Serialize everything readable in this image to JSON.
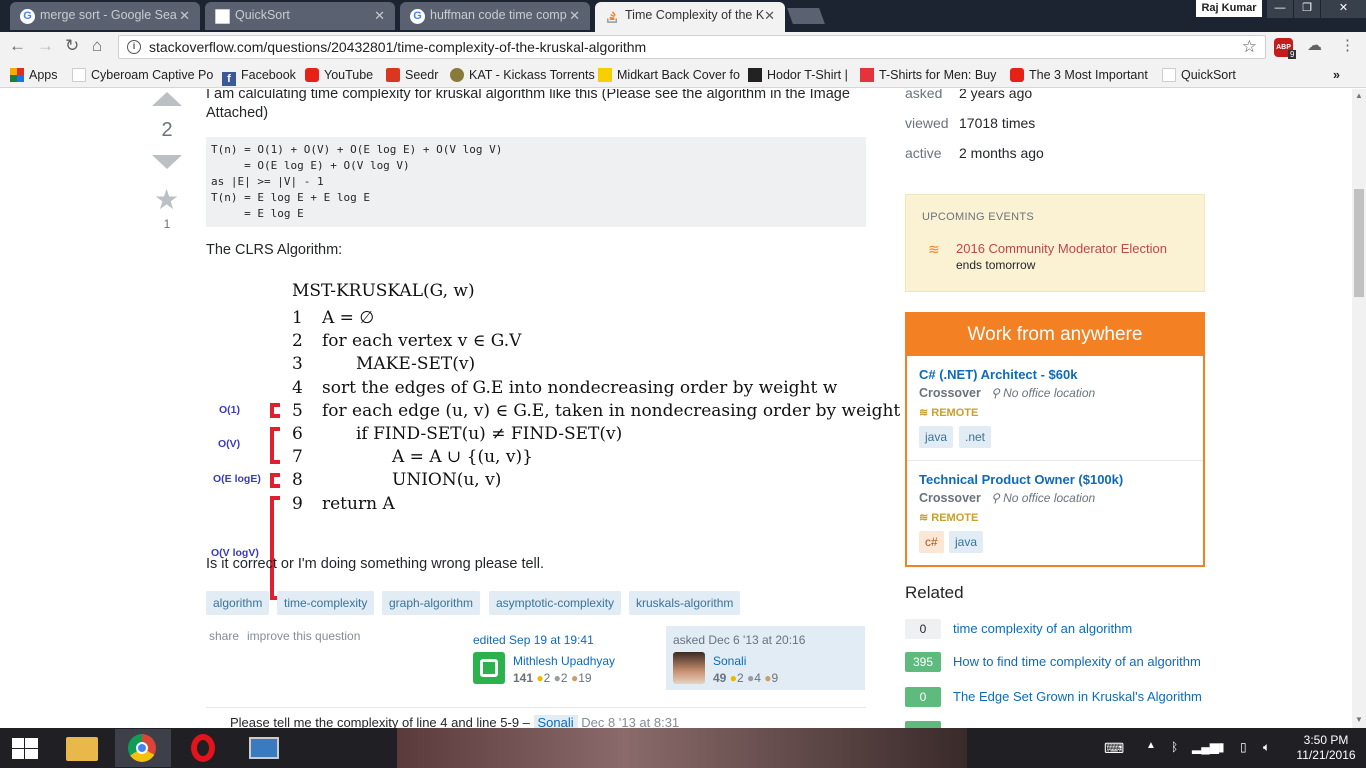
{
  "browser": {
    "tabs": [
      {
        "label": "merge sort - Google Sea",
        "icon": "google-icon"
      },
      {
        "label": "QuickSort",
        "icon": "document-icon"
      },
      {
        "label": "huffman code time comp",
        "icon": "google-icon"
      },
      {
        "label": "Time Complexity of the K",
        "icon": "stackoverflow-icon"
      }
    ],
    "user_name": "Raj Kumar",
    "url": "stackoverflow.com/questions/20432801/time-complexity-of-the-kruskal-algorithm",
    "abp_count": "9",
    "bookmarks": [
      "Apps",
      "Cyberoam Captive Po",
      "Facebook",
      "YouTube",
      "Seedr",
      "KAT - Kickass Torrents",
      "Midkart Back Cover fo",
      "Hodor T-Shirt |",
      "T-Shirts for Men: Buy",
      "The 3 Most Important",
      "QuickSort"
    ],
    "more": "»"
  },
  "question": {
    "votes": "2",
    "favorites": "1",
    "intro": "I am calculating time complexity for kruskal algorithm like this (Please see the algorithm in the Image Attached)",
    "code_lines": [
      "T(n) = O(1) + O(V) + O(E log E) + O(V log V)",
      "     = O(E log E) + O(V log V)",
      "as |E| >= |V| - 1",
      "T(n) = E log E + E log E",
      "     = E log E"
    ],
    "clrs_label": "The CLRS Algorithm:",
    "outro": "Is it correct or I'm doing something wrong please tell.",
    "tags": [
      "algorithm",
      "time-complexity",
      "graph-algorithm",
      "asymptotic-complexity",
      "kruskals-algorithm"
    ],
    "share": "share",
    "improve": "improve this question",
    "edited": {
      "when": "edited Sep 19 at 19:41",
      "name": "Mithlesh Upadhyay",
      "rep": "141",
      "gold": "2",
      "silver": "2",
      "bronze": "19"
    },
    "asked": {
      "when": "asked Dec 6 '13 at 20:16",
      "name": "Sonali",
      "rep": "49",
      "gold": "2",
      "silver": "4",
      "bronze": "9"
    },
    "comment": {
      "text": "Please tell me the complexity of line 4 and line 5-9 –",
      "user": "Sonali",
      "date": "Dec 8 '13 at 8:31"
    }
  },
  "algorithm": {
    "title": "MST-KRUSKAL(G, w)",
    "lines": [
      {
        "num": "1",
        "text": "A = ∅"
      },
      {
        "num": "2",
        "text": "for each vertex v ∈ G.V"
      },
      {
        "num": "3",
        "text": "MAKE-SET(v)"
      },
      {
        "num": "4",
        "text": "sort the edges of G.E into nondecreasing order by weight w"
      },
      {
        "num": "5",
        "text": "for each edge (u, v) ∈ G.E, taken in nondecreasing order by weight"
      },
      {
        "num": "6",
        "text": "if FIND-SET(u) ≠ FIND-SET(v)"
      },
      {
        "num": "7",
        "text": "A = A ∪ {(u, v)}"
      },
      {
        "num": "8",
        "text": "UNION(u, v)"
      },
      {
        "num": "9",
        "text": "return A"
      }
    ],
    "complexities": [
      "O(1)",
      "O(V)",
      "O(E logE)",
      "O(V logV)"
    ],
    "bracket_color": "#e0202e",
    "label_color": "#3a3ac0"
  },
  "sidebar": {
    "asked_label": "asked",
    "asked_value": "2 years ago",
    "viewed_label": "viewed",
    "viewed_value": "17018 times",
    "active_label": "active",
    "active_value": "2 months ago",
    "events_header": "UPCOMING EVENTS",
    "event_title": "2016 Community Moderator Election",
    "event_sub": "ends tomorrow",
    "jobs_header": "Work from anywhere",
    "jobs": [
      {
        "title": "C# (.NET) Architect - $60k",
        "company": "Crossover",
        "location": "No office location",
        "remote": "REMOTE",
        "tags": [
          "java",
          ".net"
        ]
      },
      {
        "title": "Technical Product Owner ($100k)",
        "company": "Crossover",
        "location": "No office location",
        "remote": "REMOTE",
        "tags": [
          "c#",
          "java"
        ]
      }
    ],
    "related_header": "Related",
    "related": [
      {
        "count": "0",
        "title": "time complexity of an algorithm"
      },
      {
        "count": "395",
        "title": "How to find time complexity of an algorithm"
      },
      {
        "count": "0",
        "title": "The Edge Set Grown in Kruskal's Algorithm"
      }
    ]
  },
  "taskbar": {
    "time": "3:50 PM",
    "date": "11/21/2016"
  }
}
